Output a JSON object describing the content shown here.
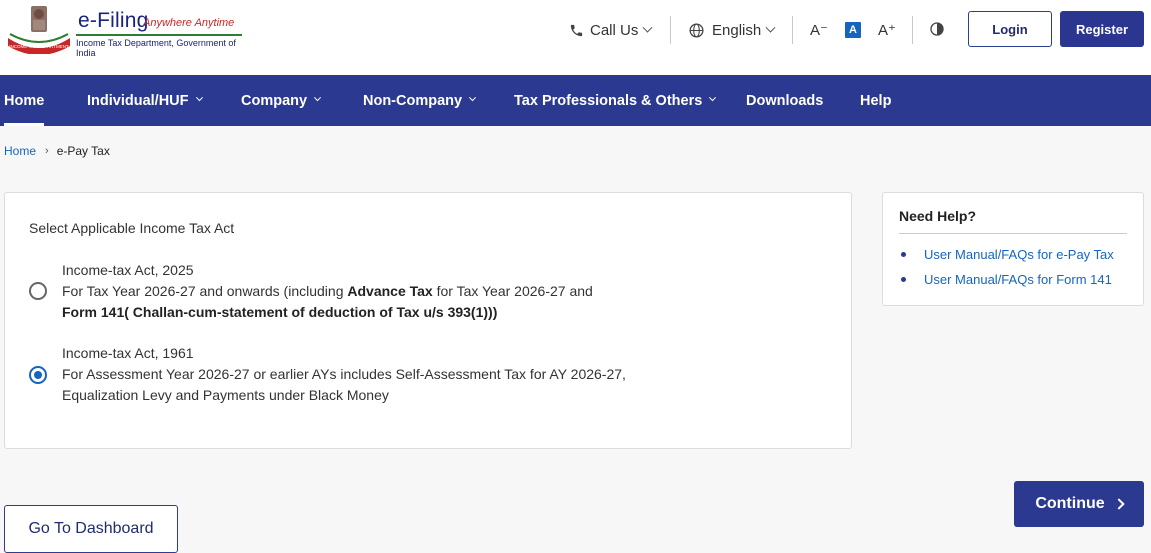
{
  "header": {
    "logo_title": "e-Filing",
    "logo_tagline": "Anywhere Anytime",
    "logo_subtitle": "Income Tax Department, Government of India",
    "call_us": "Call Us",
    "language": "English",
    "font_decrease": "A⁻",
    "font_normal": "A",
    "font_increase": "A⁺",
    "login": "Login",
    "register": "Register"
  },
  "nav": {
    "items": [
      {
        "label": "Home"
      },
      {
        "label": "Individual/HUF"
      },
      {
        "label": "Company"
      },
      {
        "label": "Non-Company"
      },
      {
        "label": "Tax Professionals & Others"
      },
      {
        "label": "Downloads"
      },
      {
        "label": "Help"
      }
    ]
  },
  "breadcrumb": {
    "home": "Home",
    "current": "e-Pay Tax"
  },
  "main": {
    "title": "Select Applicable Income Tax Act",
    "options": [
      {
        "selected": false,
        "line1": "Income-tax Act, 2025",
        "line2_pre": "For Tax Year 2026-27 and onwards (including ",
        "line2_bold": "Advance Tax",
        "line2_post": " for Tax Year 2026-27 and",
        "line3": "Form 141( Challan-cum-statement of deduction of Tax u/s 393(1)))"
      },
      {
        "selected": true,
        "line1": "Income-tax Act, 1961",
        "line2": "For Assessment Year 2026-27 or earlier AYs includes Self-Assessment Tax for AY 2026-27,",
        "line3": "Equalization Levy and Payments under Black Money"
      }
    ]
  },
  "help": {
    "title": "Need Help?",
    "links": [
      "User Manual/FAQs for e-Pay Tax",
      "User Manual/FAQs for Form 141"
    ]
  },
  "actions": {
    "continue": "Continue",
    "dashboard": "Go To Dashboard"
  },
  "colors": {
    "primary": "#2b3990",
    "link": "#1565c0",
    "logo_green": "#2e7d32",
    "logo_red": "#c62828"
  },
  "icons": {
    "emblem": "income-tax-emblem",
    "phone": "phone-icon",
    "globe": "globe-icon",
    "contrast": "contrast-icon"
  }
}
